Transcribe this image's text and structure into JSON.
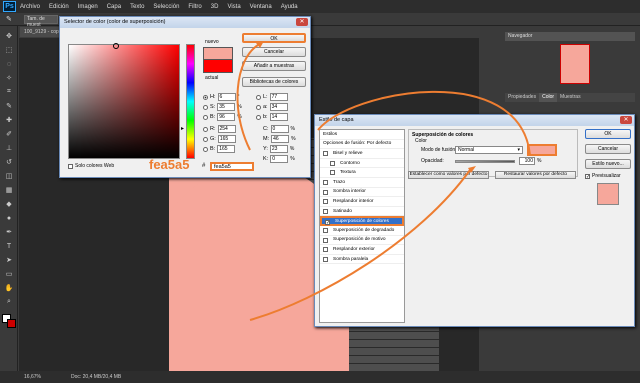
{
  "menubar": {
    "logo": "Ps",
    "items": [
      "Archivo",
      "Edición",
      "Imagen",
      "Capa",
      "Texto",
      "Selección",
      "Filtro",
      "3D",
      "Vista",
      "Ventana",
      "Ayuda"
    ]
  },
  "optionsbar": {
    "size_label": "Tam. de muest"
  },
  "document": {
    "tab": "100_9129 - copia",
    "zoom": "16,67%",
    "doc_size": "Doc: 20,4 MB/20,4 MB"
  },
  "panels": {
    "navigator": "Navegador",
    "tabs": [
      "Propiedades",
      "Color",
      "Muestras"
    ]
  },
  "color_picker": {
    "title": "Selector de color (color de superposición)",
    "new_label": "nuevo",
    "current_label": "actual",
    "ok": "OK",
    "cancel": "Cancelar",
    "add_swatch": "Añadir a muestras",
    "libraries": "Bibliotecas de colores",
    "fields": {
      "H": {
        "label": "H:",
        "value": "6",
        "unit": "°"
      },
      "S": {
        "label": "S:",
        "value": "35",
        "unit": "%"
      },
      "B": {
        "label": "B:",
        "value": "96",
        "unit": "%"
      },
      "R": {
        "label": "R:",
        "value": "254",
        "unit": ""
      },
      "G": {
        "label": "G:",
        "value": "165",
        "unit": ""
      },
      "Bl": {
        "label": "B:",
        "value": "165",
        "unit": ""
      },
      "L": {
        "label": "L:",
        "value": "77",
        "unit": ""
      },
      "a": {
        "label": "a:",
        "value": "34",
        "unit": ""
      },
      "b": {
        "label": "b:",
        "value": "14",
        "unit": ""
      },
      "C": {
        "label": "C:",
        "value": "0",
        "unit": "%"
      },
      "M": {
        "label": "M:",
        "value": "46",
        "unit": "%"
      },
      "Y": {
        "label": "Y:",
        "value": "23",
        "unit": "%"
      },
      "K": {
        "label": "K:",
        "value": "0",
        "unit": "%"
      }
    },
    "hex_label": "#",
    "hex_value": "fea5a5",
    "web_only": "Solo colores Web",
    "callout": "fea5a5"
  },
  "layer_style": {
    "title": "Estilo de capa",
    "styles_header": "Estilos",
    "blend_options": "Opciones de fusión: Por defecto",
    "items": [
      {
        "label": "Bisel y relieve",
        "checked": false
      },
      {
        "label": "Contorno",
        "checked": false
      },
      {
        "label": "Textura",
        "checked": false
      },
      {
        "label": "Trazo",
        "checked": false
      },
      {
        "label": "Sombra interior",
        "checked": false
      },
      {
        "label": "Resplandor interior",
        "checked": false
      },
      {
        "label": "Satinado",
        "checked": false
      },
      {
        "label": "Superposición de colores",
        "checked": true
      },
      {
        "label": "Superposición de degradado",
        "checked": false
      },
      {
        "label": "Superposición de motivo",
        "checked": false
      },
      {
        "label": "Resplandor exterior",
        "checked": false
      },
      {
        "label": "Sombra paralela",
        "checked": false
      }
    ],
    "section_title": "Superposición de colores",
    "section_sub": "Color",
    "blend_mode_label": "Modo de fusión:",
    "blend_mode": "Normal",
    "opacity_label": "Opacidad:",
    "opacity_value": "100",
    "opacity_unit": "%",
    "default_btn": "Establecer como valores por defecto",
    "reset_btn": "Restaurar valores por defecto",
    "ok": "OK",
    "cancel": "Cancelar",
    "new_style": "Estilo nuevo...",
    "preview": "Previsualizar"
  },
  "colors": {
    "overlay": "#f6a79b",
    "accent": "#ed7d31"
  }
}
